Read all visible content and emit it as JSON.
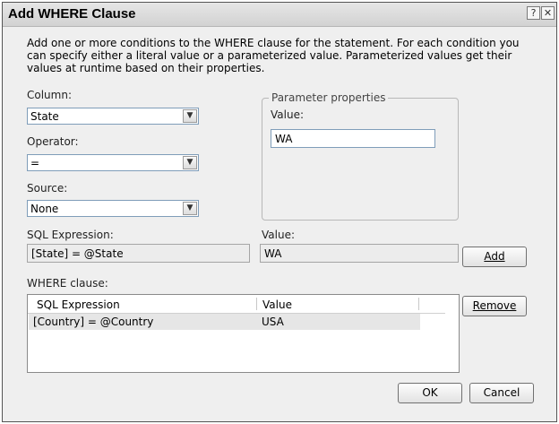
{
  "dialog": {
    "title": "Add WHERE Clause",
    "help_glyph": "?",
    "close_glyph": "✕",
    "description": "Add one or more conditions to the WHERE clause for the statement. For each condition you can specify either a literal value or a parameterized value. Parameterized values get their values at runtime based on their properties."
  },
  "column": {
    "label": "Column:",
    "value": "State"
  },
  "operator": {
    "label": "Operator:",
    "value": "="
  },
  "source": {
    "label": "Source:",
    "value": "None"
  },
  "parameter_properties": {
    "legend": "Parameter properties",
    "value_label": "Value:",
    "value": "WA"
  },
  "sql_expression": {
    "label": "SQL Expression:",
    "value": "[State] = @State"
  },
  "value_preview": {
    "label": "Value:",
    "value": "WA"
  },
  "buttons": {
    "add": "Add",
    "remove": "Remove",
    "ok": "OK",
    "cancel": "Cancel"
  },
  "where_clause": {
    "label": "WHERE clause:",
    "columns": [
      "SQL Expression",
      "Value"
    ],
    "rows": [
      {
        "expression": "[Country] = @Country",
        "value": "USA"
      }
    ]
  }
}
